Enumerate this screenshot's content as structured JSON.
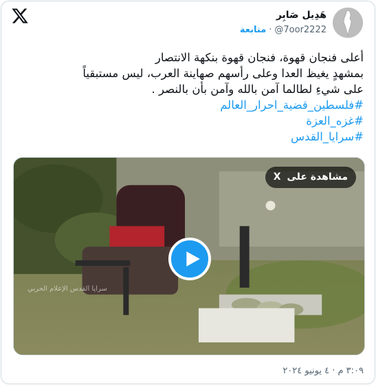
{
  "author": {
    "name": "هَدِيل صَابِر",
    "handle": "@7oor2222",
    "separator": "·",
    "follow_label": "متابعة"
  },
  "tweet": {
    "lines": [
      "أعلى فنجان قهوة، فنجان قهوة بنكهة الانتصار",
      "بمشهدٍ يغيظ العدا وعلى رأسهم صهاينة العرب،  ليس مستبقياً",
      "على شيءِ لطالما آمن بالله وآمن بأن بالنصر ."
    ],
    "hashtags": [
      "#فلسطين_قضية_احرار_العالم",
      "#غزه_العزة",
      "#سرايا_القدس"
    ]
  },
  "media": {
    "watch_label": "مشاهدة على",
    "watch_x": "X",
    "watermark": "سرايا القدس الإعلام الحربي"
  },
  "timestamp": "٣:٠٩ م · ٤ يونيو ٢٠٢٤",
  "colors": {
    "accent": "#1d9bf0",
    "text": "#0f1419",
    "muted": "#536471",
    "border": "#cfd9de"
  },
  "icons": {
    "logo": "x-logo-icon",
    "avatar": "palestine-map-avatar",
    "play": "play-icon"
  }
}
